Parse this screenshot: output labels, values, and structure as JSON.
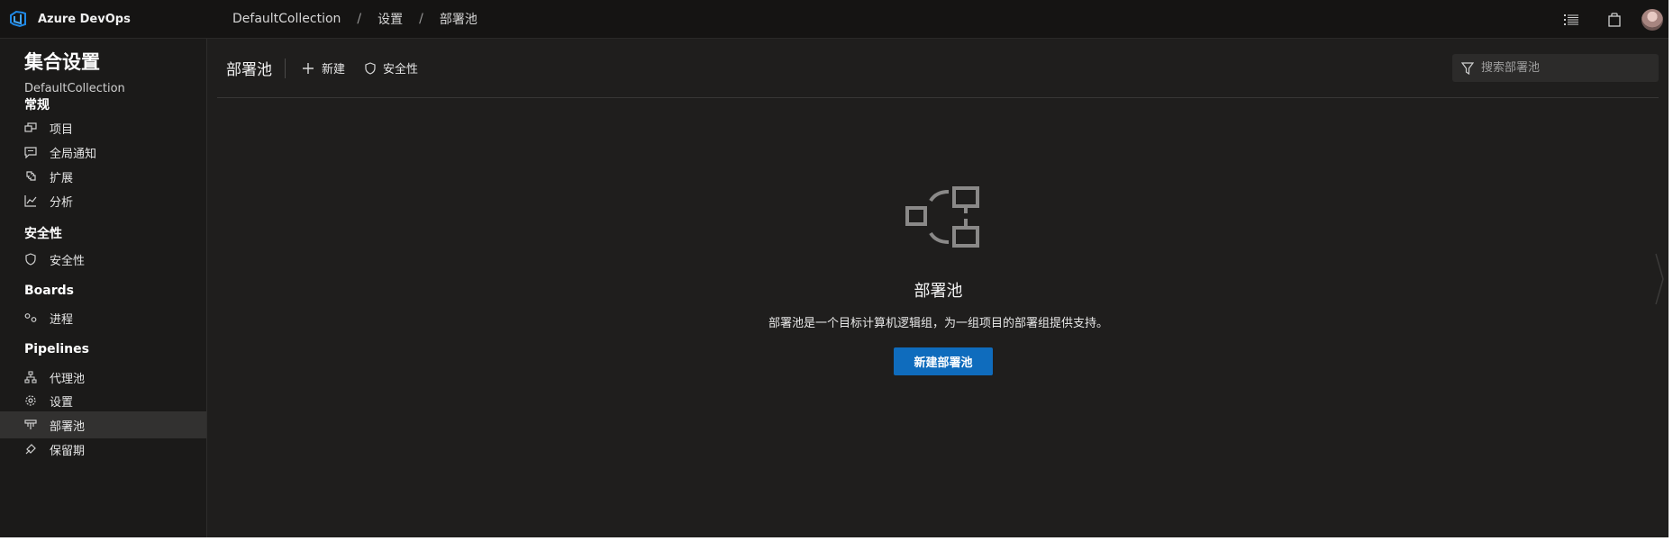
{
  "app": {
    "name": "Azure DevOps"
  },
  "breadcrumb": [
    "DefaultCollection",
    "设置",
    "部署池"
  ],
  "sidebar": {
    "title": "集合设置",
    "subtitle": "DefaultCollection",
    "sections": {
      "general": {
        "heading": "常规",
        "items": [
          "项目",
          "全局通知",
          "扩展",
          "分析"
        ]
      },
      "security": {
        "heading": "安全性",
        "items": [
          "安全性"
        ]
      },
      "boards": {
        "heading": "Boards",
        "items": [
          "进程"
        ]
      },
      "pipelines": {
        "heading": "Pipelines",
        "items": [
          "代理池",
          "设置",
          "部署池",
          "保留期"
        ]
      }
    },
    "selected": "部署池"
  },
  "toolbar": {
    "title": "部署池",
    "new_label": "新建",
    "security_label": "安全性"
  },
  "search": {
    "placeholder": "搜索部署池"
  },
  "empty": {
    "title": "部署池",
    "description": "部署池是一个目标计算机逻辑组，为一组项目的部署组提供支持。",
    "button": "新建部署池"
  },
  "colors": {
    "accent": "#0f6cbd",
    "background": "#1f1e1d",
    "sidebar": "#1b1a19",
    "selected": "#323130"
  }
}
